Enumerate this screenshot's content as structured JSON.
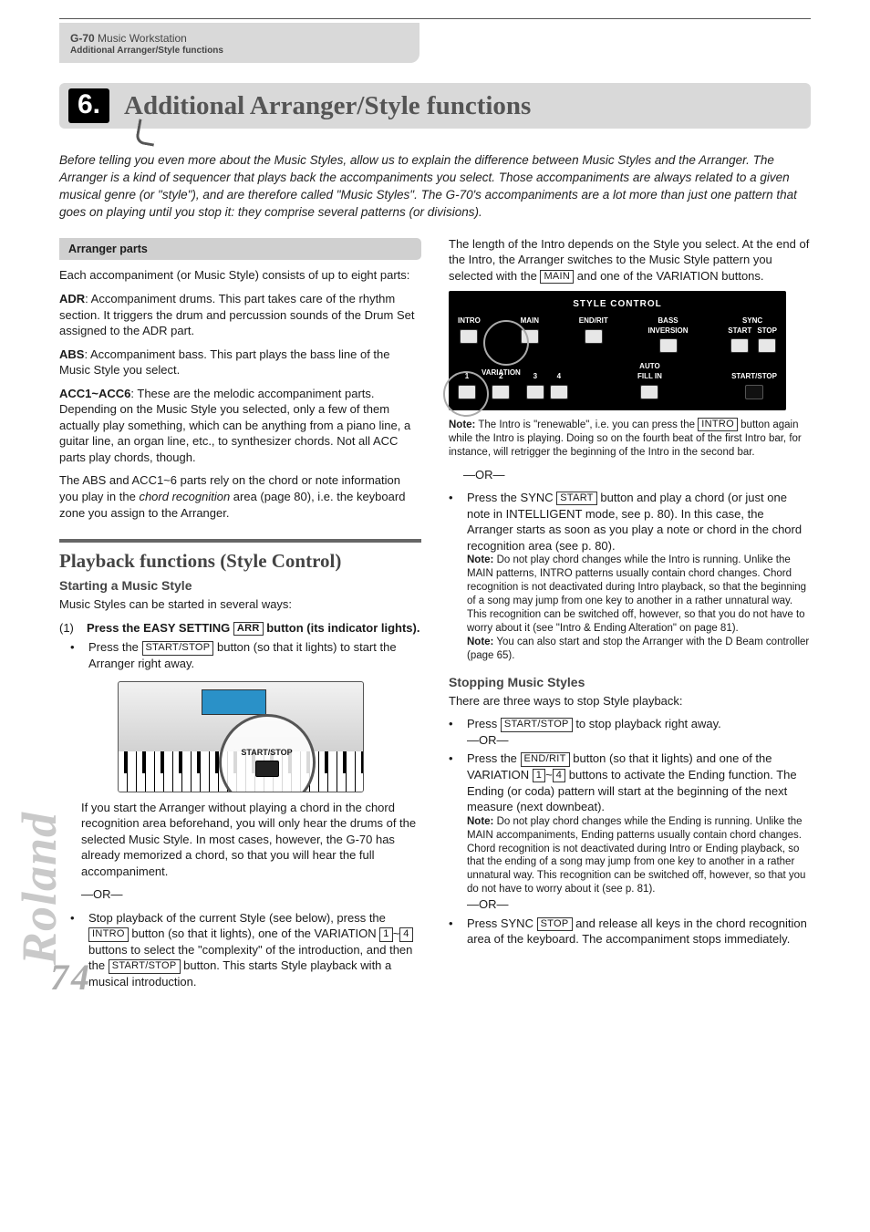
{
  "header": {
    "product": "G-70",
    "product_suffix": "Music Workstation",
    "subtitle": "Additional Arranger/Style functions"
  },
  "chapter": {
    "number": "6.",
    "title": "Additional Arranger/Style functions"
  },
  "intro": "Before telling you even more about the Music Styles, allow us to explain the difference between Music Styles and the Arranger. The Arranger is a kind of sequencer that plays back the accompaniments you select. Those accompaniments are always related to a given musical genre (or \"style\"), and are therefore called \"Music Styles\". The G-70's accompaniments are a lot more than just one pattern that goes on playing until you stop it: they comprise several patterns (or divisions).",
  "arranger_parts": {
    "heading": "Arranger parts",
    "p1": "Each accompaniment (or Music Style) consists of up to eight parts:",
    "adr_label": "ADR",
    "adr": ": Accompaniment drums. This part takes care of the rhythm section. It triggers the drum and percussion sounds of the Drum Set assigned to the ADR part.",
    "abs_label": "ABS",
    "abs": ": Accompaniment bass. This part plays the bass line of the Music Style you select.",
    "acc_label": "ACC1~ACC6",
    "acc": ": These are the melodic accompaniment parts. Depending on the Music Style you selected, only a few of them actually play something, which can be anything from a piano line, a guitar line, an organ line, etc., to synthesizer chords. Not all ACC parts play chords, though.",
    "p2a": "The ABS and ACC1~6 parts rely on the chord or note information you play in the ",
    "p2_it": "chord recognition",
    "p2b": " area (page 80), i.e. the keyboard zone you assign to the Arranger."
  },
  "playback": {
    "title": "Playback functions (Style Control)",
    "start_heading": "Starting a Music Style",
    "start_line": "Music Styles can be started in several ways:",
    "step1_num": "(1)",
    "step1a": "Press the EASY SETTING ",
    "step1_btn": "ARR",
    "step1b": " button (its indicator lights).",
    "b1a": "Press the ",
    "b1_btn": "START/STOP",
    "b1b": " button (so that it lights) to start the Arranger right away.",
    "fig_label": "START/STOP",
    "post_fig": "If you start the Arranger without playing a chord in the chord recognition area beforehand, you will only hear the drums of the selected Music Style. In most cases, however, the G-70 has already memorized a chord, so that you will hear the full accompaniment.",
    "or1": "—OR—",
    "b2a": "Stop playback of the current Style (see below), press the ",
    "b2_btn1": "INTRO",
    "b2b": " button (so that it lights), one of the VARIATION ",
    "b2_btn2": "1",
    "b2_tilde": "~",
    "b2_btn3": "4",
    "b2c": " buttons to select the \"complexity\" of the introduction, and then the ",
    "b2_btn4": "START/STOP",
    "b2d": " button. This starts Style playback with a musical introduction."
  },
  "col2": {
    "p1a": "The length of the Intro depends on the Style you select. At the end of the Intro, the Arranger switches to the Music Style pattern you selected with the ",
    "p1_btn": "MAIN",
    "p1b": " and one of the VARIATION buttons.",
    "panel": {
      "title": "STYLE CONTROL",
      "intro": "INTRO",
      "main": "MAIN",
      "endrit": "END/RIT",
      "bass_inv": "BASS\nINVERSION",
      "sync": "SYNC",
      "sync_start": "START",
      "sync_stop": "STOP",
      "variation": "VARIATION",
      "v1": "1",
      "v2": "2",
      "v3": "3",
      "v4": "4",
      "autofill": "AUTO\nFILL IN",
      "startstop": "START/STOP"
    },
    "note1_label": "Note:",
    "note1a": " The Intro is \"renewable\", i.e. you can press the ",
    "note1_btn": "INTRO",
    "note1b": " button again while the Intro is playing. Doing so on the fourth beat of the first Intro bar, for instance, will retrigger the beginning of the Intro in the second bar.",
    "or2": "—OR—",
    "b3a": "Press the SYNC ",
    "b3_btn": "START",
    "b3b": " button and play a chord (or just one note in INTELLIGENT mode, see p. 80). In this case, the Arranger starts as soon as you play a note or chord in the chord recognition area (see p. 80).",
    "b3_note1_label": "Note:",
    "b3_note1": " Do not play chord changes while the Intro is running. Unlike the MAIN patterns, INTRO patterns usually contain chord changes. Chord recognition is not deactivated during Intro playback, so that the beginning of a song may jump from one key to another in a rather unnatural way. This recognition can be switched off, however, so that you do not have to worry about it (see \"Intro & Ending Alteration\" on page 81).",
    "b3_note2_label": "Note:",
    "b3_note2": " You can also start and stop the Arranger with the D Beam controller (page 65).",
    "stop_heading": "Stopping Music Styles",
    "stop_line": "There are three ways to stop Style playback:",
    "s1a": "Press ",
    "s1_btn": "START/STOP",
    "s1b": " to stop playback right away.",
    "or3": "—OR—",
    "s2a": "Press the ",
    "s2_btn1": "END/RIT",
    "s2b": " button (so that it lights) and one of the VARIATION ",
    "s2_btn2": "1",
    "s2_tilde": "~",
    "s2_btn3": "4",
    "s2c": " buttons to activate the Ending function. The Ending (or coda) pattern will start at the beginning of the next measure (next downbeat).",
    "s2_note_label": "Note:",
    "s2_note": " Do not play chord changes while the Ending is running. Unlike the MAIN accompaniments, Ending patterns usually contain chord changes. Chord recognition is not deactivated during Intro or Ending playback, so that the ending of a song may jump from one key to another in a rather unnatural way. This recognition can be switched off, however, so that you do not have to worry about it (see p. 81).",
    "or4": "—OR—",
    "s3a": "Press SYNC ",
    "s3_btn": "STOP",
    "s3b": " and release all keys in the chord recognition area of the keyboard. The accompaniment stops immediately."
  },
  "brand": "Roland",
  "page_number": "74"
}
